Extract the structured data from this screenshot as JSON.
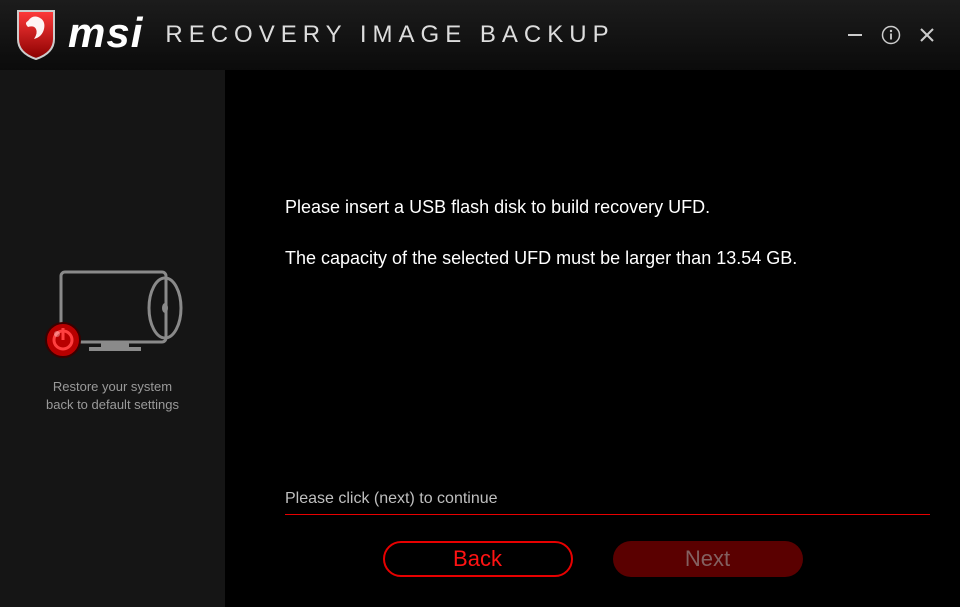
{
  "header": {
    "brand": "msi",
    "title": "RECOVERY IMAGE BACKUP"
  },
  "sidebar": {
    "caption_line1": "Restore your system",
    "caption_line2": "back to default settings"
  },
  "main": {
    "instruction_line1": "Please insert a USB flash disk to build recovery UFD.",
    "instruction_line2": "The capacity of the selected UFD must be larger than 13.54 GB.",
    "hint": "Please click (next) to continue",
    "back_label": "Back",
    "next_label": "Next"
  }
}
